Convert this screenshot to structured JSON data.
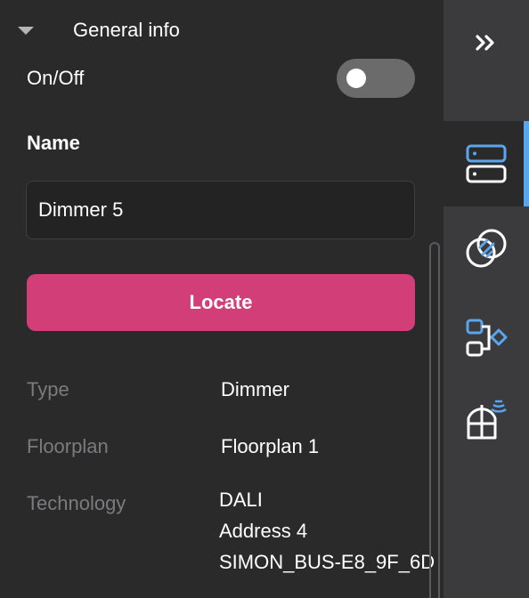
{
  "section": {
    "title": "General info"
  },
  "onoff": {
    "label": "On/Off",
    "state": "off"
  },
  "name": {
    "label": "Name",
    "value": "Dimmer 5"
  },
  "locate": {
    "label": "Locate"
  },
  "info": {
    "type": {
      "key": "Type",
      "value": "Dimmer"
    },
    "floorplan": {
      "key": "Floorplan",
      "value": "Floorplan 1"
    },
    "technology": {
      "key": "Technology",
      "lines": [
        "DALI",
        "Address 4",
        "SIMON_BUS-E8_9F_6D"
      ]
    }
  },
  "sidebar": {
    "items": [
      {
        "icon": "double-chevron-right-icon"
      },
      {
        "icon": "server-icon",
        "active": true
      },
      {
        "icon": "overlapping-circles-icon"
      },
      {
        "icon": "flow-diagram-icon"
      },
      {
        "icon": "window-sensor-icon"
      }
    ]
  },
  "colors": {
    "accent": "#d13e78",
    "active": "#59a5ee",
    "background": "#2a2a2b",
    "sidebar": "#3b3b3d"
  }
}
